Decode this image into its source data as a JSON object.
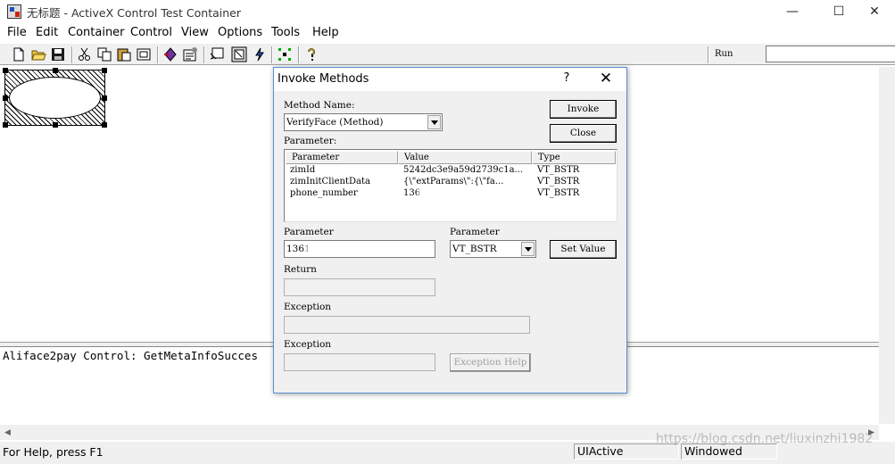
{
  "window": {
    "title": "无标题 - ActiveX Control Test Container",
    "minimize": "—",
    "maximize": "☐",
    "close": "✕"
  },
  "menu": [
    "File",
    "Edit",
    "Container",
    "Control",
    "View",
    "Options",
    "Tools",
    "Help"
  ],
  "toolbar": {
    "icons": [
      "new-icon",
      "open-icon",
      "save-icon",
      "cut-icon",
      "copy-icon",
      "paste-icon",
      "insert-control-icon",
      "properties-icon",
      "invoke-methods-icon",
      "select-icon",
      "event-log-icon",
      "dots-icon",
      "help-icon"
    ],
    "run_label": "Run",
    "run_value": ""
  },
  "output": {
    "line": "Aliface2pay Control: GetMetaInfoSucces"
  },
  "status": {
    "help_text": "For Help, press F1",
    "state": "UIActive",
    "mode": "Windowed"
  },
  "watermark": "https://blog.csdn.net/liuxinzhi1982",
  "dialog": {
    "title": "Invoke Methods",
    "help_button": "?",
    "close_button": "✕",
    "method_name_label": "Method Name:",
    "method_name_value": "VerifyFace (Method)",
    "invoke_button": "Invoke",
    "close_label": "Close",
    "parameters_label": "Parameter:",
    "columns": [
      "Parameter",
      "Value",
      "Type"
    ],
    "rows": [
      {
        "name": "zimId",
        "value": "5242dc3e9a59d2739c1a...",
        "type": "VT_BSTR"
      },
      {
        "name": "zimInitClientData",
        "value": "{\\\"extParams\\\":{\\\"fa...",
        "type": "VT_BSTR"
      },
      {
        "name": "phone_number",
        "value": "136",
        "type": "VT_BSTR"
      }
    ],
    "parameter_label": "Parameter",
    "parameter_value": "1361",
    "type_label": "Parameter",
    "type_value": "VT_BSTR",
    "set_value_button": "Set Value",
    "return_label": "Return",
    "return_value": "",
    "exception_label": "Exception",
    "exception_value": "",
    "exception2_label": "Exception",
    "exception2_value": "",
    "exception_help_button": "Exception Help"
  }
}
